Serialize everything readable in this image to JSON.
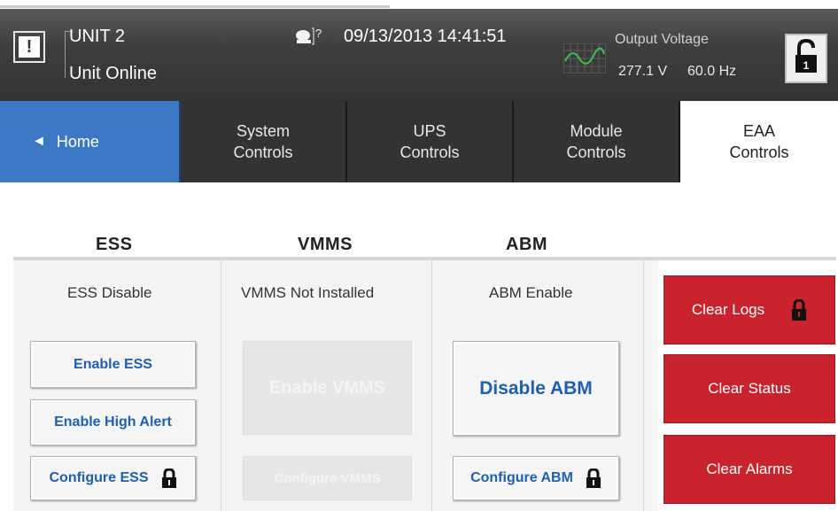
{
  "header": {
    "unit_title": "UNIT 2",
    "unit_status": "Unit Online",
    "alert_icon": "!",
    "datetime": "09/13/2013 14:41:51",
    "help_icon_text": "?",
    "output_voltage_label": "Output Voltage",
    "voltage": "277.1 V",
    "frequency": "60.0 Hz",
    "lock_icon_text": "1"
  },
  "nav": {
    "home": "Home",
    "home_arrow": "◄",
    "tabs": [
      {
        "line1": "System",
        "line2": "Controls"
      },
      {
        "line1": "UPS",
        "line2": "Controls"
      },
      {
        "line1": "Module",
        "line2": "Controls"
      },
      {
        "line1": "EAA",
        "line2": "Controls"
      }
    ]
  },
  "sections": {
    "ess": "ESS",
    "vmms": "VMMS",
    "abm": "ABM"
  },
  "ess": {
    "status": "ESS Disable",
    "enable": "Enable ESS",
    "high_alert": "Enable High Alert",
    "configure": "Configure ESS"
  },
  "vmms": {
    "status": "VMMS Not Installed",
    "enable": "Enable VMMS",
    "configure": "Configure VMMS"
  },
  "abm": {
    "status": "ABM Enable",
    "disable": "Disable ABM",
    "configure": "Configure ABM"
  },
  "actions": {
    "clear_logs": "Clear Logs",
    "clear_status": "Clear Status",
    "clear_alarms": "Clear Alarms"
  },
  "colors": {
    "home_tab": "#3d78c4",
    "action_red": "#c9232d",
    "button_text_blue": "#1f5fad",
    "waveform_green": "#3fbf4f"
  }
}
